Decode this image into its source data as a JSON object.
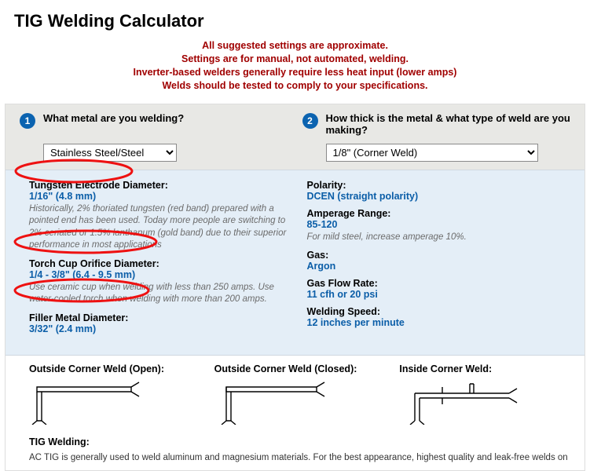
{
  "title": "TIG Welding Calculator",
  "notice": {
    "l1": "All suggested settings are approximate.",
    "l2": "Settings are for manual, not automated, welding.",
    "l3": "Inverter-based welders generally require less heat input (lower amps)",
    "l4": "Welds should be tested to comply to your specifications."
  },
  "q1": {
    "num": "1",
    "text": "What metal are you welding?",
    "selected": "Stainless Steel/Steel"
  },
  "q2": {
    "num": "2",
    "text": "How thick is the metal & what type of weld are you making?",
    "selected": "1/8\" (Corner Weld)"
  },
  "left": {
    "electrode": {
      "label": "Tungsten Electrode Diameter:",
      "value": "1/16\" (4.8 mm)",
      "note": "Historically, 2% thoriated tungsten (red band) prepared with a pointed end has been used. Today more people are switching to 2% ceriated or 1.5% lanthanum (gold band) due to their superior performance in most applications"
    },
    "torch": {
      "label": "Torch Cup Orifice Diameter:",
      "value": "1/4 - 3/8\" (6.4 - 9.5 mm)",
      "note": "Use ceramic cup when welding with less than 250 amps. Use water-cooled torch when welding with more than 200 amps."
    },
    "filler": {
      "label": "Filler Metal Diameter:",
      "value": "3/32\" (2.4 mm)"
    }
  },
  "right": {
    "polarity": {
      "label": "Polarity:",
      "value": "DCEN (straight polarity)"
    },
    "amperage": {
      "label": "Amperage Range:",
      "value": "85-120",
      "note": "For mild steel, increase amperage 10%."
    },
    "gas": {
      "label": "Gas:",
      "value": "Argon"
    },
    "flow": {
      "label": "Gas Flow Rate:",
      "value": "11 cfh or 20 psi"
    },
    "speed": {
      "label": "Welding Speed:",
      "value": "12 inches per minute"
    }
  },
  "diagrams": {
    "d1": "Outside Corner Weld (Open):",
    "d2": "Outside Corner Weld (Closed):",
    "d3": "Inside Corner Weld:"
  },
  "tig": {
    "title": "TIG Welding:",
    "body": "AC TIG is generally used to weld aluminum and magnesium materials. For the best appearance, highest quality and leak-free welds on"
  }
}
